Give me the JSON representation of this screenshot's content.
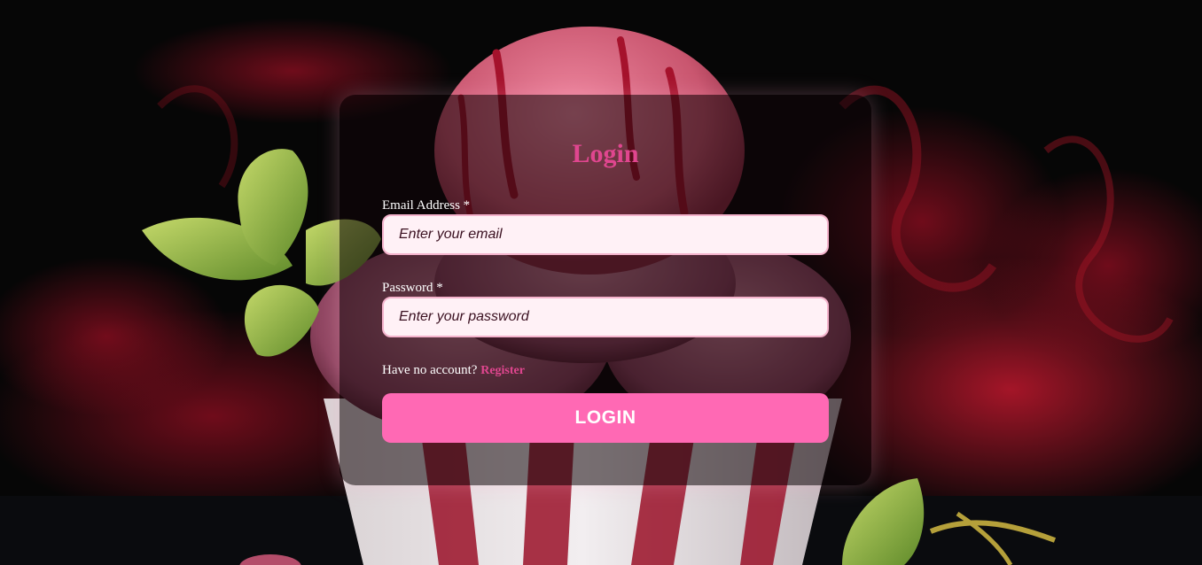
{
  "login": {
    "title": "Login",
    "email": {
      "label": "Email Address",
      "required_mark": "*",
      "placeholder": "Enter your email",
      "value": ""
    },
    "password": {
      "label": "Password",
      "required_mark": "*",
      "placeholder": "Enter your password",
      "value": ""
    },
    "signup_prompt": "Have no account?",
    "signup_link": "Register",
    "submit_label": "LOGIN"
  },
  "colors": {
    "accent": "#e0468f",
    "button": "#ff69b4",
    "input_bg": "#fff1f6"
  }
}
